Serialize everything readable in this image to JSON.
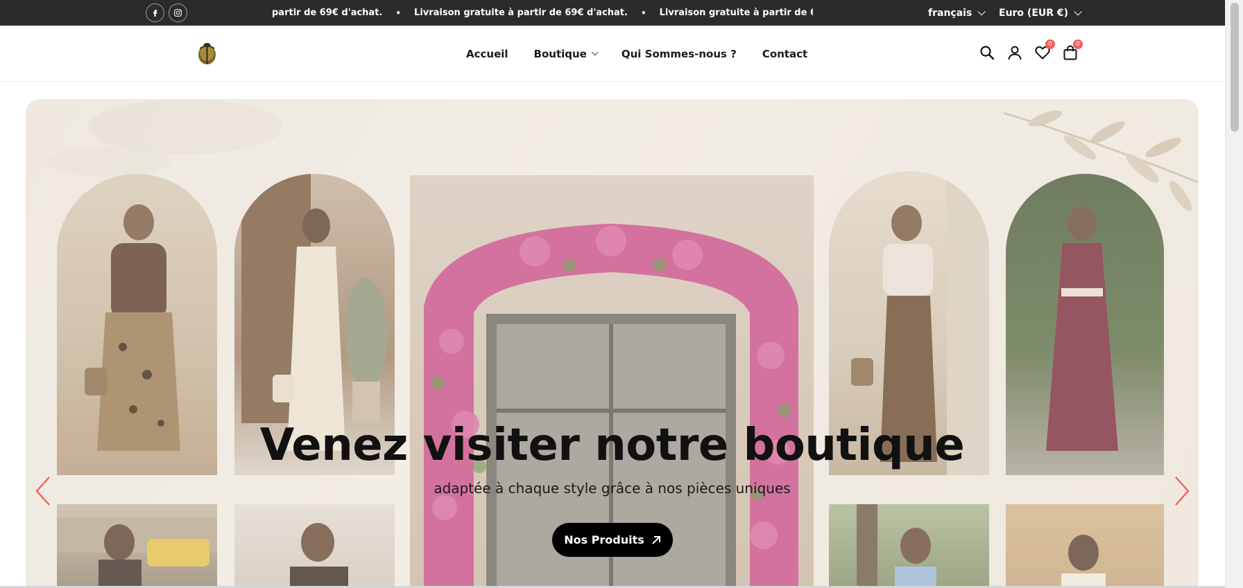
{
  "topbar": {
    "social": [
      {
        "icon": "facebook-icon",
        "glyph": "f"
      },
      {
        "icon": "instagram-icon"
      }
    ],
    "announcement_partial": "partir de 69€ d'achat.",
    "announcement": "Livraison gratuite à partir de 69€ d'achat.",
    "separator": "•",
    "language": "français",
    "currency": "Euro (EUR €)"
  },
  "header": {
    "logo_icon": "scarab-logo-icon",
    "nav": [
      {
        "label": "Accueil"
      },
      {
        "label": "Boutique",
        "has_dropdown": true
      },
      {
        "label": "Qui Sommes-nous ?"
      },
      {
        "label": "Contact"
      }
    ],
    "icons": [
      "search-icon",
      "account-icon",
      "wishlist-icon",
      "cart-icon"
    ],
    "wishlist_count": "0",
    "cart_count": "0"
  },
  "hero": {
    "title": "Venez visiter notre boutique",
    "subtitle": "adaptée à chaque style grâce à nos pièces uniques",
    "button_label": "Nos Produits",
    "button_icon": "arrow-up-right-icon",
    "prev_icon": "chevron-left-icon",
    "next_icon": "chevron-right-icon"
  },
  "colors": {
    "topbar_bg": "#2b2b2b",
    "badge": "#f25f5c",
    "arrow": "#f0605b",
    "button_bg": "#000000"
  }
}
